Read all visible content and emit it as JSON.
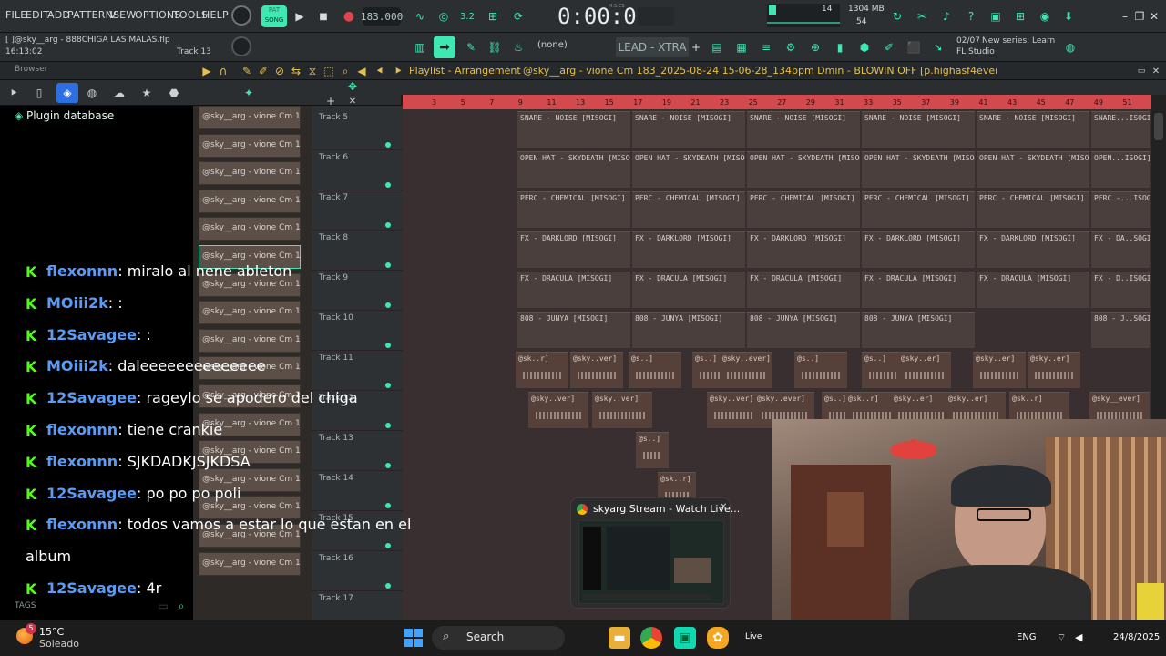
{
  "menu": {
    "items": [
      "FILE",
      "EDIT",
      "ADD",
      "PATTERNS",
      "VIEW",
      "OPTIONS",
      "TOOLS",
      "HELP"
    ]
  },
  "transport": {
    "pat_label": "PAT",
    "song_label": "SONG",
    "tempo": "183.000",
    "time": "0:00:00",
    "time_unit": "M:S:CS",
    "cpu_value": "14",
    "mem": "1304 MB",
    "poly": "54"
  },
  "project": {
    "file_line": "[    ]@sky__arg - 888CHIGA LAS MALAS.flp",
    "clock": "16:13:02",
    "track_label": "Track 13"
  },
  "toolbar2": {
    "snap": "(none)",
    "preset": "LEAD - XTRA",
    "news_date": "02/07",
    "news_text": "New series: Learn",
    "news_text2": "FL Studio"
  },
  "browser": {
    "title": "Browser",
    "plugin_db": "Plugin database",
    "tags_label": "TAGS"
  },
  "playlist": {
    "title": "Playlist - Arrangement",
    "pattern": "@sky__arg - vione Cm 183_2025-08-24 15-06-28_134bpm Dmin - BLOWIN OFF [p.highasf4ever]"
  },
  "channels": [
    "@sky__arg - vione Cm 18..",
    "@sky__arg - vione Cm 18..",
    "@sky__arg - vione Cm 18..",
    "@sky__arg - vione Cm 18..",
    "@sky__arg - vione Cm 18..",
    "@sky__arg - vione Cm 18..",
    "@sky__arg - vione Cm 18..",
    "@sky__arg - vione Cm 18..",
    "@sky__arg - vione Cm 18..",
    "@sky__arg - vione Cm 18..",
    "@sky__arg - vione Cm 18..",
    "@sky__arg - vione Cm 18..",
    "@sky__arg - vione Cm 18..",
    "@sky__arg - vione Cm 18..",
    "@sky__arg - vione Cm 18..",
    "@sky__arg - vione Cm 18..",
    "@sky__arg - vione Cm 18.."
  ],
  "tracks": [
    "Track 5",
    "Track 6",
    "Track 7",
    "Track 8",
    "Track 9",
    "Track 10",
    "Track 11",
    "Track 12",
    "Track 13",
    "Track 14",
    "Track 15",
    "Track 16",
    "Track 17"
  ],
  "ruler": [
    "3",
    "5",
    "7",
    "9",
    "11",
    "13",
    "15",
    "17",
    "19",
    "21",
    "23",
    "25",
    "27",
    "29",
    "31",
    "33",
    "35",
    "37",
    "39",
    "41",
    "43",
    "45",
    "47",
    "49",
    "51"
  ],
  "clips": {
    "t5": "SNARE - NOISE [MISOGI]",
    "t5_last": "SNARE...ISOGI]",
    "t6": "OPEN HAT - SKYDEATH [MISOGI]",
    "t6_last": "OPEN...ISOGI]",
    "t7": "PERC - CHEMICAL [MISOGI]",
    "t7_last": "PERC -...ISOGI]",
    "t8": "FX - DARKLORD [MISOGI]",
    "t8_last": "FX - DA..SOGI]",
    "t9": "FX - DRACULA [MISOGI]",
    "t9_last": "FX - D..ISOGI]",
    "t10": "808 - JUNYA [MISOGI]",
    "t10_last": "808 - J..SOGI]",
    "w1": "@sk..r]",
    "w2": "@sky..ver]",
    "w3": "@s..]",
    "w4": "@sky..ever]",
    "w5": "@sky..er]",
    "w6": "@sk..r]",
    "w7": "@s..]",
    "w8": "@sky__ever]"
  },
  "chat": [
    {
      "user": "flexonnn",
      "color": "#5b9bf3",
      "msg": "miralo al nene ableton"
    },
    {
      "user": "MOiii2k",
      "color": "#5b9bf3",
      "msg": ":"
    },
    {
      "user": "12Savagee",
      "color": "#5b9bf3",
      "msg": ":"
    },
    {
      "user": "MOiii2k",
      "color": "#5b9bf3",
      "msg": "daleeeeeeeeeeeeee"
    },
    {
      "user": "12Savagee",
      "color": "#5b9bf3",
      "msg": "rageylo se apodero del chiga"
    },
    {
      "user": "flexonnn",
      "color": "#5b9bf3",
      "msg": "tiene crankie"
    },
    {
      "user": "flexonnn",
      "color": "#5b9bf3",
      "msg": "SJKDADKJSJKDSA"
    },
    {
      "user": "12Savagee",
      "color": "#5b9bf3",
      "msg": "po po po poli"
    },
    {
      "user": "flexonnn",
      "color": "#5b9bf3",
      "msg": "todos vamos a estar lo que estan en el"
    },
    {
      "user": "",
      "color": "#5b9bf3",
      "msg": "album"
    },
    {
      "user": "12Savagee",
      "color": "#5b9bf3",
      "msg": "4r"
    }
  ],
  "preview": {
    "title": "skyarg Stream - Watch Live..."
  },
  "taskbar": {
    "temp": "15°C",
    "weather": "Soleado",
    "search": "Search",
    "lang": "ENG",
    "date": "24/8/2025",
    "live": "Live",
    "badge": "5"
  },
  "colors": {
    "accent": "#3fe8b0",
    "ruler": "#d2494e",
    "kick": "#53fc18"
  }
}
